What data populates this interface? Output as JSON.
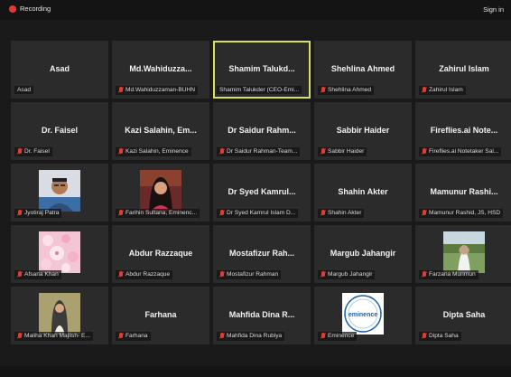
{
  "topbar": {
    "recording_label": "Recording",
    "signin_label": "Sign in"
  },
  "rows": [
    [
      {
        "name": "Asad",
        "label": "Asad",
        "muted": false
      },
      {
        "name": "Md.Wahiduzza...",
        "label": "Md.Wahiduzzaman-BUHN",
        "muted": true
      },
      {
        "name": "Shamim  Talukd...",
        "label": "Shamim Talukder (CEO-Emi...",
        "muted": false,
        "active": true
      },
      {
        "name": "Shehlina Ahmed",
        "label": "Shehlina Ahmed",
        "muted": true
      },
      {
        "name": "Zahirul Islam",
        "label": "Zahirul Islam",
        "muted": true
      }
    ],
    [
      {
        "name": "Dr. Faisel",
        "label": "Dr. Faisel",
        "muted": true
      },
      {
        "name": "Kazi Salahin, Em...",
        "label": "Kazi Salahin, Eminence",
        "muted": true
      },
      {
        "name": "Dr Saidur Rahm...",
        "label": "Dr Saidur Rahman-Team...",
        "muted": true
      },
      {
        "name": "Sabbir Haider",
        "label": "Sabbir Haider",
        "muted": true
      },
      {
        "name": "Fireflies.ai Note...",
        "label": "Fireflies.ai Notetaker Sal...",
        "muted": true
      }
    ],
    [
      {
        "name": "",
        "label": "Jyotiraj Patra",
        "muted": true,
        "photo": "man"
      },
      {
        "name": "",
        "label": "Farihin Sultana, Eminenc...",
        "muted": true,
        "photo": "woman"
      },
      {
        "name": "Dr Syed Kamrul...",
        "label": "Dr Syed Kamrul Islam D...",
        "muted": true
      },
      {
        "name": "Shahin Akter",
        "label": "Shahin Akter",
        "muted": true
      },
      {
        "name": "Mamunur  Rashi...",
        "label": "Mamunur Rashid, JS, HSD",
        "muted": true
      }
    ],
    [
      {
        "name": "",
        "label": "Afsana Khan",
        "muted": true,
        "photo": "flowers"
      },
      {
        "name": "Abdur Razzaque",
        "label": "Abdur Razzaque",
        "muted": true
      },
      {
        "name": "Mostafizur  Rah...",
        "label": "Mostafizur Rahman",
        "muted": true
      },
      {
        "name": "Margub Jahangir",
        "label": "Margub Jahangir",
        "muted": true
      },
      {
        "name": "",
        "label": "Farzana Munmun",
        "muted": true,
        "photo": "outdoor"
      }
    ],
    [
      {
        "name": "",
        "label": "Maliha Khan Majlish- E...",
        "muted": true,
        "photo": "hijab"
      },
      {
        "name": "Farhana",
        "label": "Farhana",
        "muted": true
      },
      {
        "name": "Mahfida Dina R...",
        "label": "Mahfida Dina Rubiya",
        "muted": true
      },
      {
        "name": "",
        "label": "Eminence",
        "muted": true,
        "photo": "logo",
        "logo_text": "eminence"
      },
      {
        "name": "Dipta Saha",
        "label": "Dipta Saha",
        "muted": true
      }
    ]
  ],
  "colors": {
    "tile_bg": "#2b2b2b",
    "active_border": "#d6e35a",
    "muted_icon": "#e53935"
  }
}
